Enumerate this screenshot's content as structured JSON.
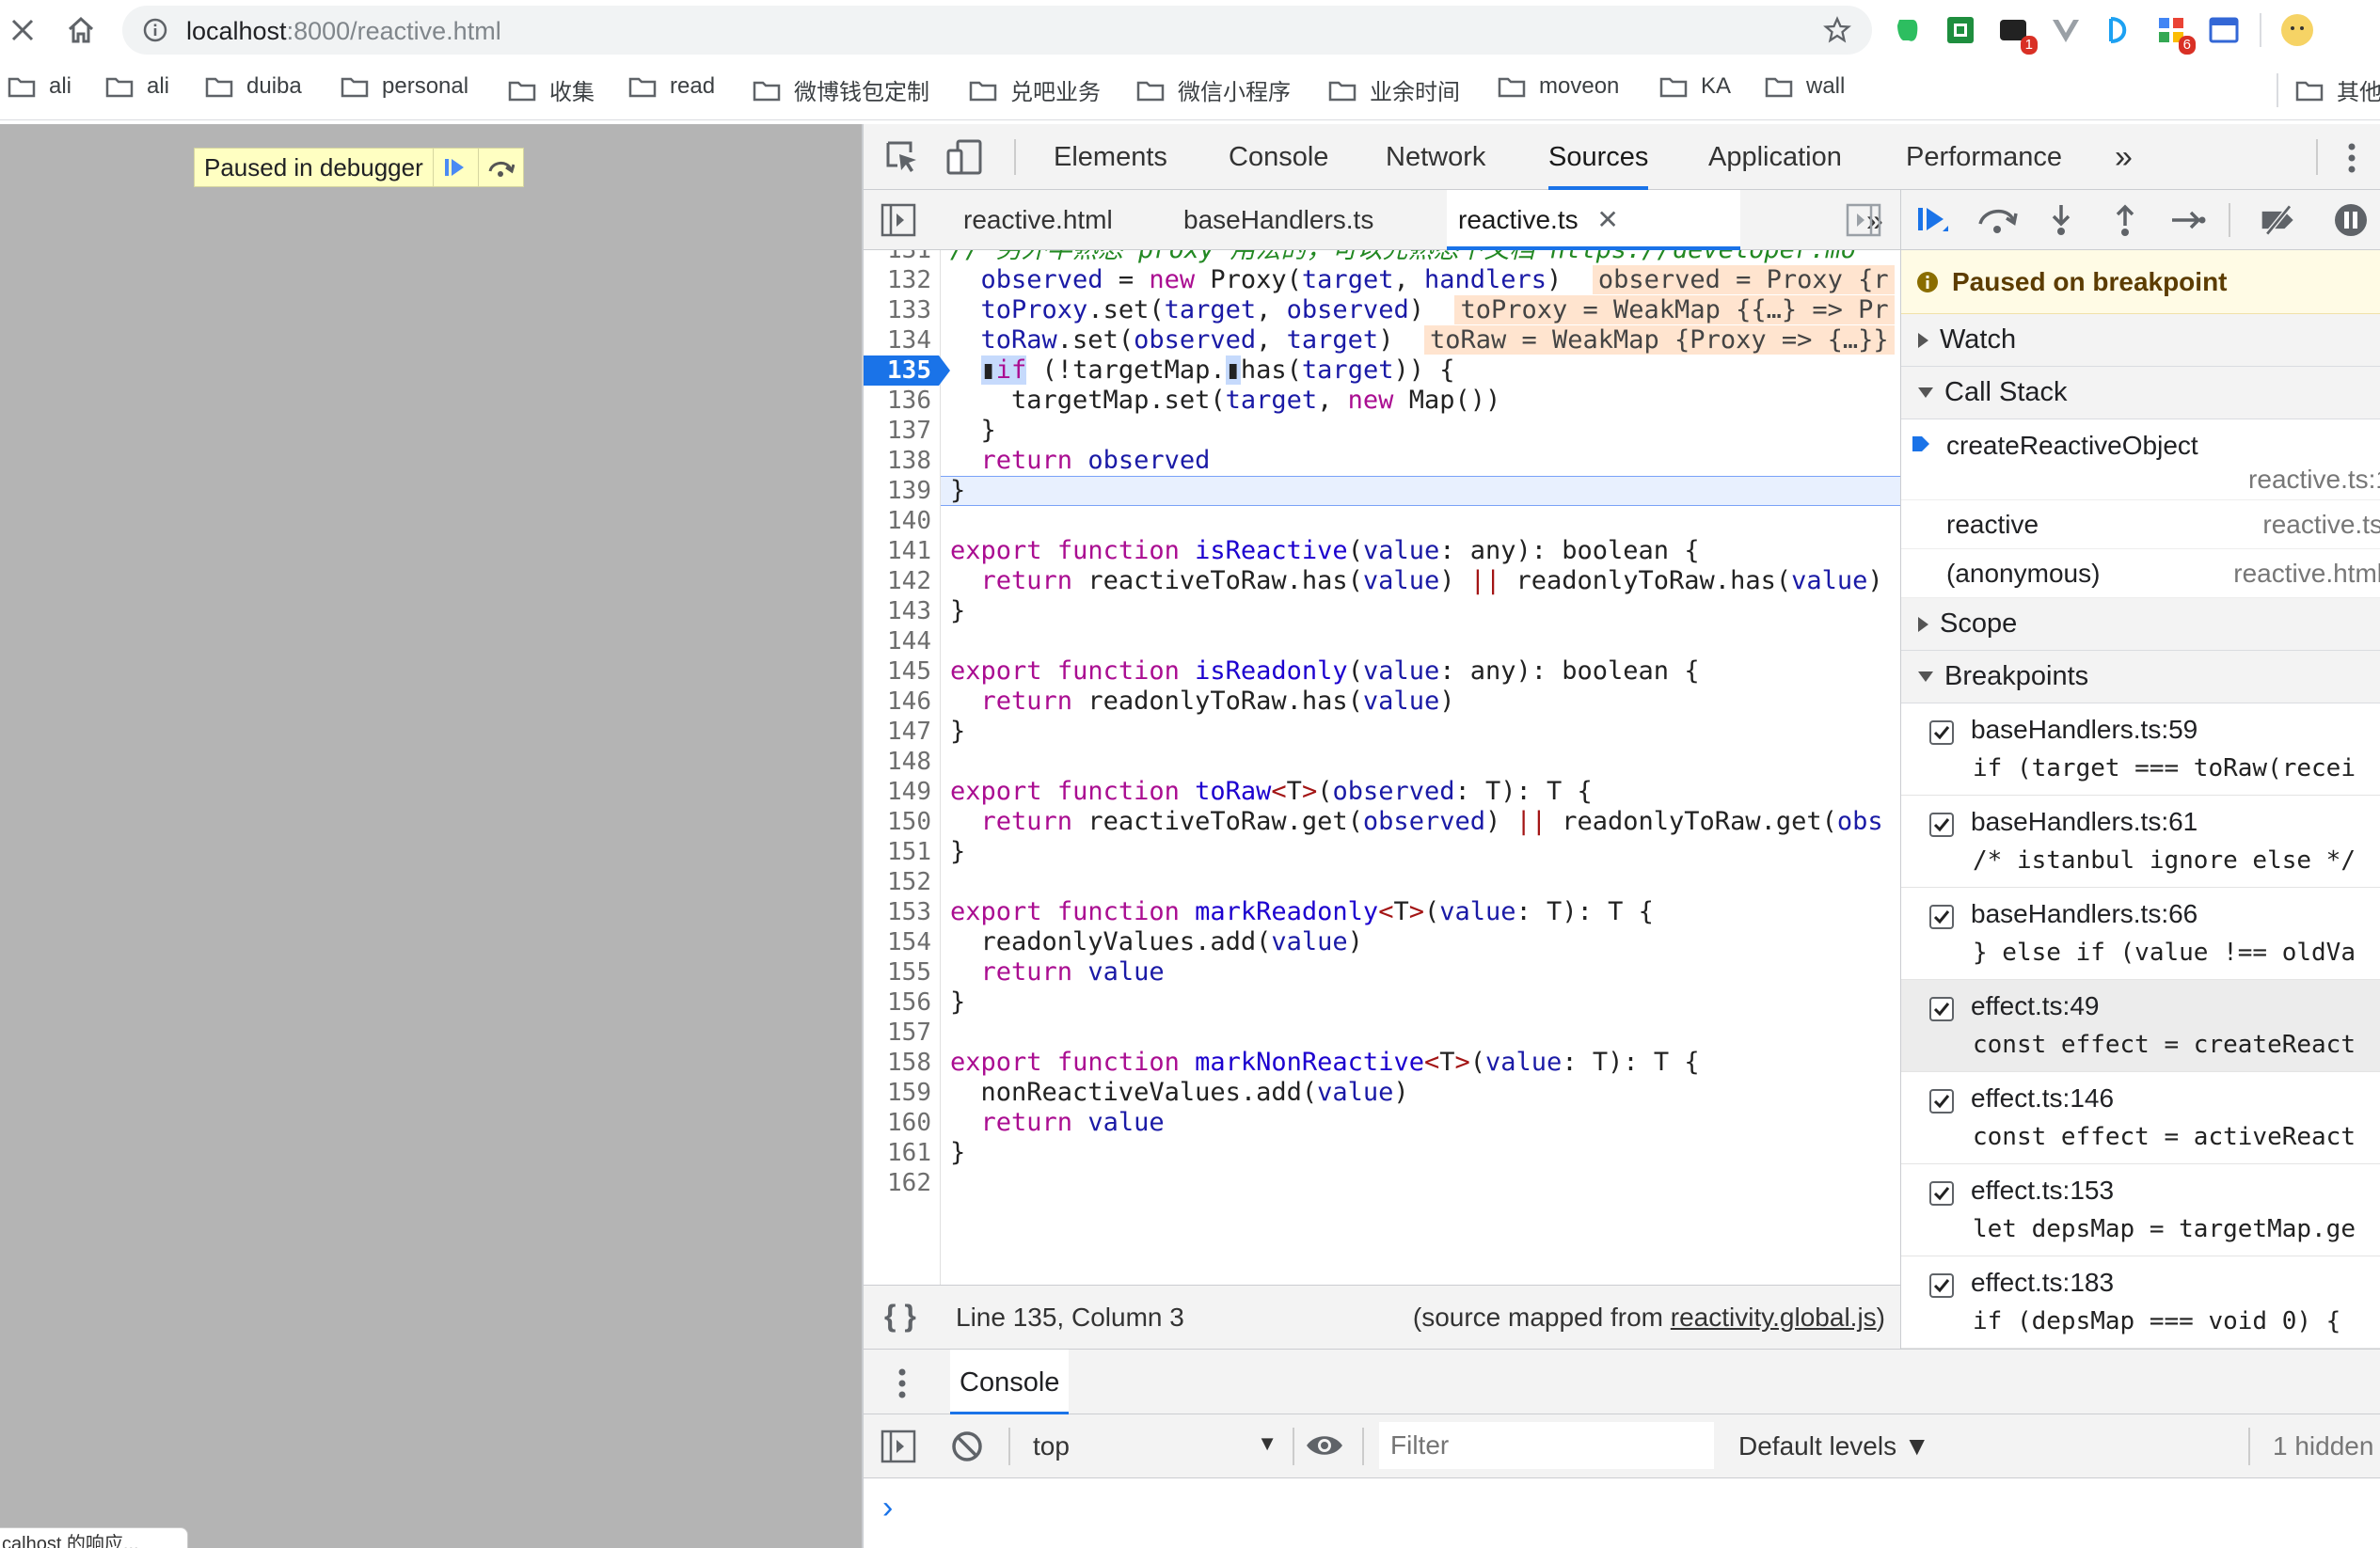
{
  "browser": {
    "url_host": "localhost",
    "url_rest": ":8000/reactive.html",
    "ext_badges": [
      "1",
      "6"
    ],
    "bookmarks": [
      "ali",
      "ali",
      "duiba",
      "personal",
      "收集",
      "read",
      "微博钱包定制",
      "兑吧业务",
      "微信小程序",
      "业余时间",
      "moveon",
      "KA",
      "wall",
      "其他"
    ]
  },
  "page": {
    "paused_text": "Paused in debugger",
    "status_tip": "calhost 的响应..."
  },
  "devtools": {
    "tabs": [
      "Elements",
      "Console",
      "Network",
      "Sources",
      "Application",
      "Performance"
    ],
    "more_tabs": "»",
    "active_tab": "Sources",
    "source_tabs": [
      "reactive.html",
      "baseHandlers.ts",
      "reactive.ts"
    ],
    "active_source_tab": "reactive.ts",
    "code": {
      "first_line_fragment": "// 另外半熟悉 proxy 用法的，可以先熟悉下文档 https://developer.mo",
      "current_line": 135,
      "inline_values": {
        "l132": "observed = Proxy {r",
        "l133": "toProxy = WeakMap {{…} => Pr",
        "l134": "toRaw = WeakMap {Proxy => {…}}"
      }
    },
    "status": {
      "position": "Line 135, Column 3",
      "source_map_prefix": "(source mapped from ",
      "source_map_link": "reactivity.global.js",
      "source_map_suffix": ")"
    },
    "sidebar": {
      "paused_banner": "Paused on breakpoint",
      "watch": "Watch",
      "call_stack": "Call Stack",
      "call_stack_items": [
        {
          "fn": "createReactiveObject",
          "loc": "reactive.ts:1"
        },
        {
          "fn": "reactive",
          "loc": "reactive.ts"
        },
        {
          "fn": "(anonymous)",
          "loc": "reactive.html"
        }
      ],
      "scope": "Scope",
      "breakpoints": "Breakpoints",
      "breakpoint_items": [
        {
          "file": "baseHandlers.ts:59",
          "code": "if (target === toRaw(recei"
        },
        {
          "file": "baseHandlers.ts:61",
          "code": "/* istanbul ignore else */"
        },
        {
          "file": "baseHandlers.ts:66",
          "code": "} else if (value !== oldVa"
        },
        {
          "file": "effect.ts:49",
          "code": "const effect = createReact"
        },
        {
          "file": "effect.ts:146",
          "code": "const effect = activeReact"
        },
        {
          "file": "effect.ts:153",
          "code": "let depsMap = targetMap.ge"
        },
        {
          "file": "effect.ts:183",
          "code": "if (depsMap === void 0) {"
        }
      ]
    },
    "drawer": {
      "title": "Console",
      "context": "top",
      "filter_placeholder": "Filter",
      "levels": "Default levels ▼",
      "hidden": "1 hidden",
      "prompt": "›"
    }
  }
}
